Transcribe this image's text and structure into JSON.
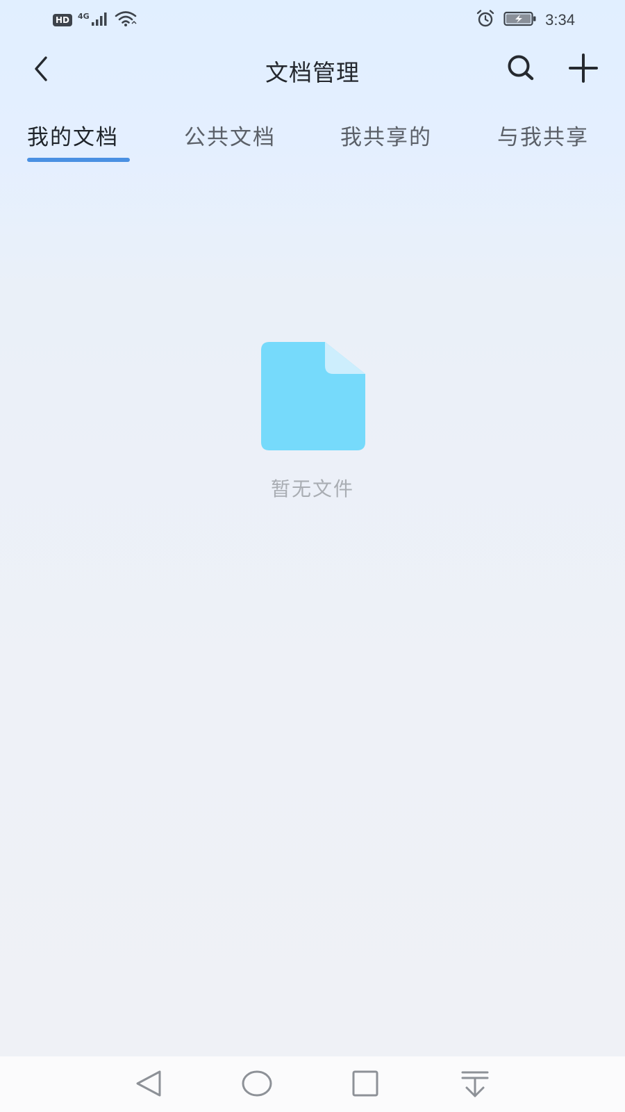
{
  "status_bar": {
    "hd_label": "HD",
    "network_label": "4G",
    "time": "3:34",
    "icons": [
      "hd-icon",
      "signal-icon",
      "wifi-icon",
      "alarm-icon",
      "battery-charging-icon"
    ]
  },
  "header": {
    "title": "文档管理",
    "back_icon": "chevron-left-icon",
    "search_icon": "search-icon",
    "add_icon": "plus-icon"
  },
  "tabs": {
    "active_index": 0,
    "items": [
      {
        "label": "我的文档"
      },
      {
        "label": "公共文档"
      },
      {
        "label": "我共享的"
      },
      {
        "label": "与我共享"
      }
    ]
  },
  "empty_state": {
    "icon": "document-icon",
    "message": "暂无文件"
  },
  "nav_bar": {
    "icons": [
      "back-triangle-icon",
      "home-circle-icon",
      "recents-square-icon",
      "notification-pulldown-icon"
    ]
  },
  "colors": {
    "accent": "#4a90e2",
    "file_icon": "#76dafb",
    "file_icon_fold": "#cdeefd",
    "empty_text": "#a9adb3",
    "header_bg": "#e1efff",
    "page_bg": "#eef1f7"
  }
}
